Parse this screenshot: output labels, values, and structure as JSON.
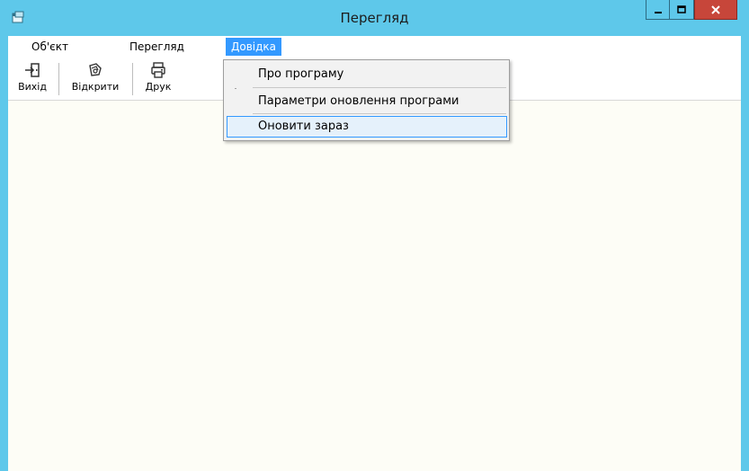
{
  "window": {
    "title": "Перегляд",
    "accent": "#5ec8ea",
    "close_color": "#c7463a",
    "icons": {
      "app": "app-window-icon",
      "minimize": "minimize-icon",
      "maximize": "maximize-icon",
      "close": "close-icon"
    }
  },
  "menubar": {
    "items": [
      {
        "label": "Об'єкт"
      },
      {
        "label": "Перегляд"
      },
      {
        "label": "Довідка",
        "active": true
      }
    ]
  },
  "toolbar": {
    "items": [
      {
        "label": "Вихід",
        "icon": "exit-icon"
      },
      {
        "label": "Відкрити",
        "icon": "open-icon"
      },
      {
        "label": "Друк",
        "icon": "printer-icon"
      }
    ]
  },
  "dropdown": {
    "items": [
      {
        "label": "Про програму"
      },
      {
        "label": "Параметри оновлення програми"
      },
      {
        "label": "Оновити зараз",
        "highlighted": true
      }
    ]
  }
}
